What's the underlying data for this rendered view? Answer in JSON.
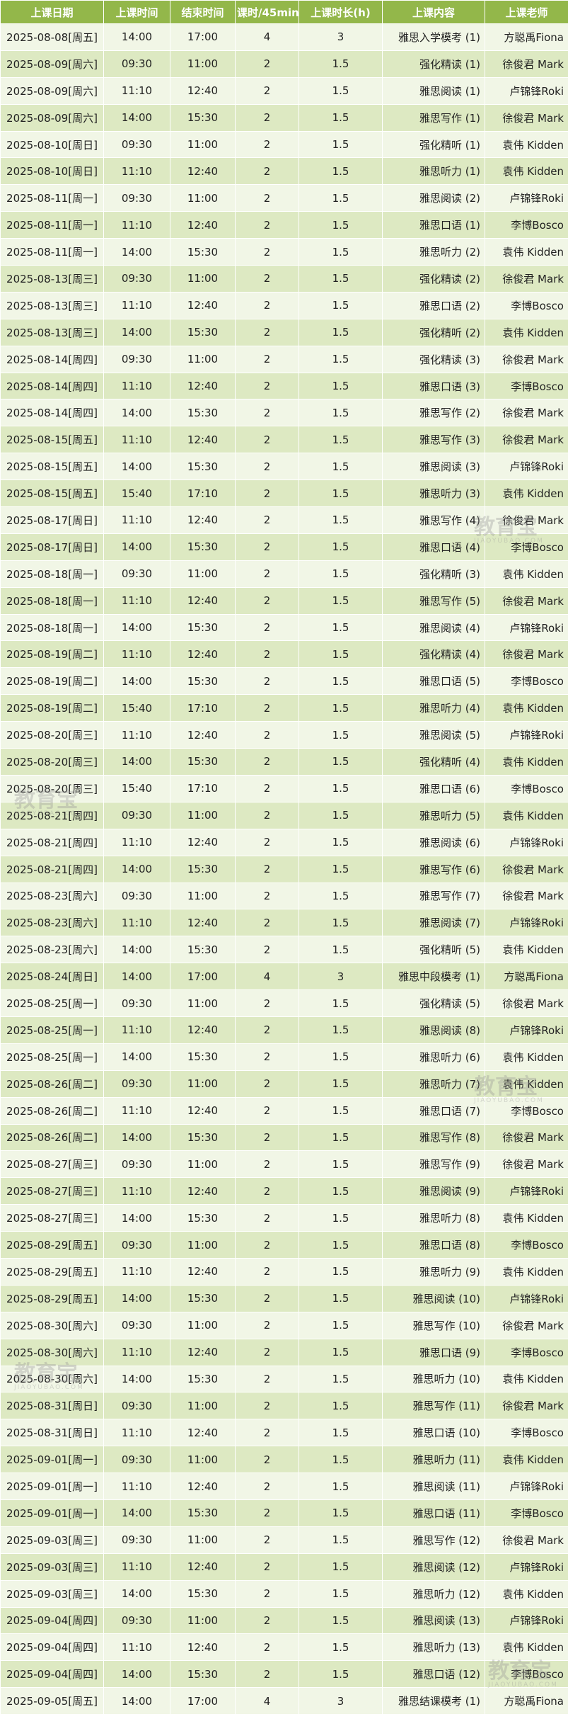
{
  "header": [
    "上课日期",
    "上课时间",
    "结束时间",
    "课时/45min",
    "上课时长(h)",
    "上课内容",
    "上课老师"
  ],
  "rows": [
    [
      "2025-08-08[周五]",
      "14:00",
      "17:00",
      "4",
      "3",
      "雅思入学模考 (1)",
      "方聪禹Fiona"
    ],
    [
      "2025-08-09[周六]",
      "09:30",
      "11:00",
      "2",
      "1.5",
      "强化精读 (1)",
      "徐俊君 Mark"
    ],
    [
      "2025-08-09[周六]",
      "11:10",
      "12:40",
      "2",
      "1.5",
      "雅思阅读 (1)",
      "卢锦锋Roki"
    ],
    [
      "2025-08-09[周六]",
      "14:00",
      "15:30",
      "2",
      "1.5",
      "雅思写作 (1)",
      "徐俊君 Mark"
    ],
    [
      "2025-08-10[周日]",
      "09:30",
      "11:00",
      "2",
      "1.5",
      "强化精听 (1)",
      "袁伟 Kidden"
    ],
    [
      "2025-08-10[周日]",
      "11:10",
      "12:40",
      "2",
      "1.5",
      "雅思听力 (1)",
      "袁伟 Kidden"
    ],
    [
      "2025-08-11[周一]",
      "09:30",
      "11:00",
      "2",
      "1.5",
      "雅思阅读 (2)",
      "卢锦锋Roki"
    ],
    [
      "2025-08-11[周一]",
      "11:10",
      "12:40",
      "2",
      "1.5",
      "雅思口语 (1)",
      "李博Bosco"
    ],
    [
      "2025-08-11[周一]",
      "14:00",
      "15:30",
      "2",
      "1.5",
      "雅思听力 (2)",
      "袁伟 Kidden"
    ],
    [
      "2025-08-13[周三]",
      "09:30",
      "11:00",
      "2",
      "1.5",
      "强化精读 (2)",
      "徐俊君 Mark"
    ],
    [
      "2025-08-13[周三]",
      "11:10",
      "12:40",
      "2",
      "1.5",
      "雅思口语 (2)",
      "李博Bosco"
    ],
    [
      "2025-08-13[周三]",
      "14:00",
      "15:30",
      "2",
      "1.5",
      "强化精听 (2)",
      "袁伟 Kidden"
    ],
    [
      "2025-08-14[周四]",
      "09:30",
      "11:00",
      "2",
      "1.5",
      "强化精读 (3)",
      "徐俊君 Mark"
    ],
    [
      "2025-08-14[周四]",
      "11:10",
      "12:40",
      "2",
      "1.5",
      "雅思口语 (3)",
      "李博Bosco"
    ],
    [
      "2025-08-14[周四]",
      "14:00",
      "15:30",
      "2",
      "1.5",
      "雅思写作 (2)",
      "徐俊君 Mark"
    ],
    [
      "2025-08-15[周五]",
      "11:10",
      "12:40",
      "2",
      "1.5",
      "雅思写作 (3)",
      "徐俊君 Mark"
    ],
    [
      "2025-08-15[周五]",
      "14:00",
      "15:30",
      "2",
      "1.5",
      "雅思阅读 (3)",
      "卢锦锋Roki"
    ],
    [
      "2025-08-15[周五]",
      "15:40",
      "17:10",
      "2",
      "1.5",
      "雅思听力 (3)",
      "袁伟 Kidden"
    ],
    [
      "2025-08-17[周日]",
      "11:10",
      "12:40",
      "2",
      "1.5",
      "雅思写作 (4)",
      "徐俊君 Mark"
    ],
    [
      "2025-08-17[周日]",
      "14:00",
      "15:30",
      "2",
      "1.5",
      "雅思口语 (4)",
      "李博Bosco"
    ],
    [
      "2025-08-18[周一]",
      "09:30",
      "11:00",
      "2",
      "1.5",
      "强化精听 (3)",
      "袁伟 Kidden"
    ],
    [
      "2025-08-18[周一]",
      "11:10",
      "12:40",
      "2",
      "1.5",
      "雅思写作 (5)",
      "徐俊君 Mark"
    ],
    [
      "2025-08-18[周一]",
      "14:00",
      "15:30",
      "2",
      "1.5",
      "雅思阅读 (4)",
      "卢锦锋Roki"
    ],
    [
      "2025-08-19[周二]",
      "11:10",
      "12:40",
      "2",
      "1.5",
      "强化精读 (4)",
      "徐俊君 Mark"
    ],
    [
      "2025-08-19[周二]",
      "14:00",
      "15:30",
      "2",
      "1.5",
      "雅思口语 (5)",
      "李博Bosco"
    ],
    [
      "2025-08-19[周二]",
      "15:40",
      "17:10",
      "2",
      "1.5",
      "雅思听力 (4)",
      "袁伟 Kidden"
    ],
    [
      "2025-08-20[周三]",
      "11:10",
      "12:40",
      "2",
      "1.5",
      "雅思阅读 (5)",
      "卢锦锋Roki"
    ],
    [
      "2025-08-20[周三]",
      "14:00",
      "15:30",
      "2",
      "1.5",
      "强化精听 (4)",
      "袁伟 Kidden"
    ],
    [
      "2025-08-20[周三]",
      "15:40",
      "17:10",
      "2",
      "1.5",
      "雅思口语 (6)",
      "李博Bosco"
    ],
    [
      "2025-08-21[周四]",
      "09:30",
      "11:00",
      "2",
      "1.5",
      "雅思听力 (5)",
      "袁伟 Kidden"
    ],
    [
      "2025-08-21[周四]",
      "11:10",
      "12:40",
      "2",
      "1.5",
      "雅思阅读 (6)",
      "卢锦锋Roki"
    ],
    [
      "2025-08-21[周四]",
      "14:00",
      "15:30",
      "2",
      "1.5",
      "雅思写作 (6)",
      "徐俊君 Mark"
    ],
    [
      "2025-08-23[周六]",
      "09:30",
      "11:00",
      "2",
      "1.5",
      "雅思写作 (7)",
      "徐俊君 Mark"
    ],
    [
      "2025-08-23[周六]",
      "11:10",
      "12:40",
      "2",
      "1.5",
      "雅思阅读 (7)",
      "卢锦锋Roki"
    ],
    [
      "2025-08-23[周六]",
      "14:00",
      "15:30",
      "2",
      "1.5",
      "强化精听 (5)",
      "袁伟 Kidden"
    ],
    [
      "2025-08-24[周日]",
      "14:00",
      "17:00",
      "4",
      "3",
      "雅思中段模考 (1)",
      "方聪禹Fiona"
    ],
    [
      "2025-08-25[周一]",
      "09:30",
      "11:00",
      "2",
      "1.5",
      "强化精读 (5)",
      "徐俊君 Mark"
    ],
    [
      "2025-08-25[周一]",
      "11:10",
      "12:40",
      "2",
      "1.5",
      "雅思阅读 (8)",
      "卢锦锋Roki"
    ],
    [
      "2025-08-25[周一]",
      "14:00",
      "15:30",
      "2",
      "1.5",
      "雅思听力 (6)",
      "袁伟 Kidden"
    ],
    [
      "2025-08-26[周二]",
      "09:30",
      "11:00",
      "2",
      "1.5",
      "雅思听力 (7)",
      "袁伟 Kidden"
    ],
    [
      "2025-08-26[周二]",
      "11:10",
      "12:40",
      "2",
      "1.5",
      "雅思口语 (7)",
      "李博Bosco"
    ],
    [
      "2025-08-26[周二]",
      "14:00",
      "15:30",
      "2",
      "1.5",
      "雅思写作 (8)",
      "徐俊君 Mark"
    ],
    [
      "2025-08-27[周三]",
      "09:30",
      "11:00",
      "2",
      "1.5",
      "雅思写作 (9)",
      "徐俊君 Mark"
    ],
    [
      "2025-08-27[周三]",
      "11:10",
      "12:40",
      "2",
      "1.5",
      "雅思阅读 (9)",
      "卢锦锋Roki"
    ],
    [
      "2025-08-27[周三]",
      "14:00",
      "15:30",
      "2",
      "1.5",
      "雅思听力 (8)",
      "袁伟 Kidden"
    ],
    [
      "2025-08-29[周五]",
      "09:30",
      "11:00",
      "2",
      "1.5",
      "雅思口语 (8)",
      "李博Bosco"
    ],
    [
      "2025-08-29[周五]",
      "11:10",
      "12:40",
      "2",
      "1.5",
      "雅思听力 (9)",
      "袁伟 Kidden"
    ],
    [
      "2025-08-29[周五]",
      "14:00",
      "15:30",
      "2",
      "1.5",
      "雅思阅读 (10)",
      "卢锦锋Roki"
    ],
    [
      "2025-08-30[周六]",
      "09:30",
      "11:00",
      "2",
      "1.5",
      "雅思写作 (10)",
      "徐俊君 Mark"
    ],
    [
      "2025-08-30[周六]",
      "11:10",
      "12:40",
      "2",
      "1.5",
      "雅思口语 (9)",
      "李博Bosco"
    ],
    [
      "2025-08-30[周六]",
      "14:00",
      "15:30",
      "2",
      "1.5",
      "雅思听力 (10)",
      "袁伟 Kidden"
    ],
    [
      "2025-08-31[周日]",
      "09:30",
      "11:00",
      "2",
      "1.5",
      "雅思写作 (11)",
      "徐俊君 Mark"
    ],
    [
      "2025-08-31[周日]",
      "11:10",
      "12:40",
      "2",
      "1.5",
      "雅思口语 (10)",
      "李博Bosco"
    ],
    [
      "2025-09-01[周一]",
      "09:30",
      "11:00",
      "2",
      "1.5",
      "雅思听力 (11)",
      "袁伟 Kidden"
    ],
    [
      "2025-09-01[周一]",
      "11:10",
      "12:40",
      "2",
      "1.5",
      "雅思阅读 (11)",
      "卢锦锋Roki"
    ],
    [
      "2025-09-01[周一]",
      "14:00",
      "15:30",
      "2",
      "1.5",
      "雅思口语 (11)",
      "李博Bosco"
    ],
    [
      "2025-09-03[周三]",
      "09:30",
      "11:00",
      "2",
      "1.5",
      "雅思写作 (12)",
      "徐俊君 Mark"
    ],
    [
      "2025-09-03[周三]",
      "11:10",
      "12:40",
      "2",
      "1.5",
      "雅思阅读 (12)",
      "卢锦锋Roki"
    ],
    [
      "2025-09-03[周三]",
      "14:00",
      "15:30",
      "2",
      "1.5",
      "雅思听力 (12)",
      "袁伟 Kidden"
    ],
    [
      "2025-09-04[周四]",
      "09:30",
      "11:00",
      "2",
      "1.5",
      "雅思阅读 (13)",
      "卢锦锋Roki"
    ],
    [
      "2025-09-04[周四]",
      "11:10",
      "12:40",
      "2",
      "1.5",
      "雅思听力 (13)",
      "袁伟 Kidden"
    ],
    [
      "2025-09-04[周四]",
      "14:00",
      "15:30",
      "2",
      "1.5",
      "雅思口语 (12)",
      "李博Bosco"
    ],
    [
      "2025-09-05[周五]",
      "14:00",
      "17:00",
      "4",
      "3",
      "雅思结课模考 (1)",
      "方聪禹Fiona"
    ]
  ],
  "watermark": {
    "text": "教育宝",
    "sub": "JIAOYUBAO.COM"
  }
}
